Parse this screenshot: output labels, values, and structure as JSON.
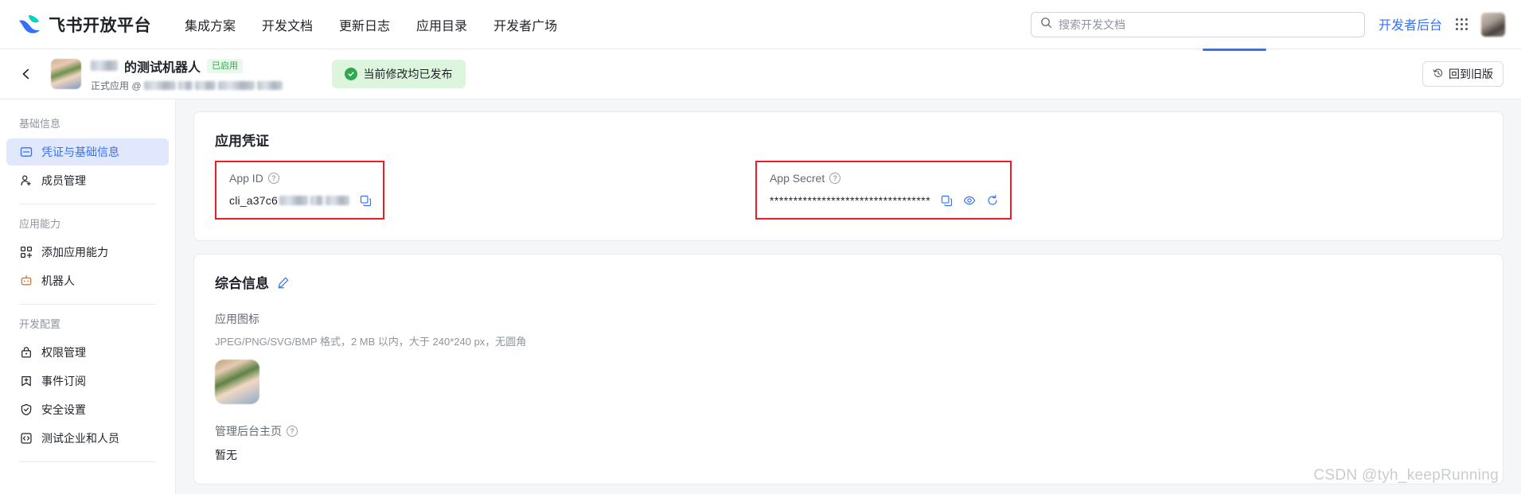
{
  "colors": {
    "accent_blue": "#3370ff",
    "success_green": "#2fa84f",
    "badge_green_bg": "#e8f8ea",
    "pill_green_bg": "#ddf5dd",
    "annotation_red": "#ee1c25",
    "sidebar_active_bg": "#e1e8fd",
    "page_bg": "#f5f6f7",
    "robot_orange": "#d97a24"
  },
  "header": {
    "brand": "飞书开放平台",
    "brand_logo_icon": "feishu-logo-icon",
    "nav": [
      {
        "label": "集成方案"
      },
      {
        "label": "开发文档"
      },
      {
        "label": "更新日志"
      },
      {
        "label": "应用目录"
      },
      {
        "label": "开发者广场"
      }
    ],
    "search": {
      "placeholder": "搜索开发文档",
      "value": "",
      "icon": "search-icon"
    },
    "dev_console_label": "开发者后台",
    "grid_icon": "app-grid-icon",
    "avatar_icon": "user-avatar"
  },
  "subheader": {
    "back_icon": "chevron-left-icon",
    "app_avatar_icon": "app-avatar-image",
    "app_name_masked_prefix": "",
    "app_name": "的测试机器人",
    "status_badge": "已启用",
    "app_type_line": "正式应用 @",
    "publish_status": "当前修改均已发布",
    "publish_icon": "check-circle-icon",
    "old_version_button": "回到旧版",
    "old_version_icon": "history-clock-icon"
  },
  "sidebar": {
    "groups": [
      {
        "title": "基础信息",
        "items": [
          {
            "label": "凭证与基础信息",
            "icon": "credentials-icon",
            "active": true
          },
          {
            "label": "成员管理",
            "icon": "member-add-icon",
            "active": false
          }
        ]
      },
      {
        "title": "应用能力",
        "items": [
          {
            "label": "添加应用能力",
            "icon": "add-capability-icon",
            "active": false
          },
          {
            "label": "机器人",
            "icon": "robot-icon",
            "active": false
          }
        ]
      },
      {
        "title": "开发配置",
        "items": [
          {
            "label": "权限管理",
            "icon": "lock-icon",
            "active": false
          },
          {
            "label": "事件订阅",
            "icon": "bookmark-plus-icon",
            "active": false
          },
          {
            "label": "安全设置",
            "icon": "shield-check-icon",
            "active": false
          },
          {
            "label": "测试企业和人员",
            "icon": "code-brackets-icon",
            "active": false
          }
        ]
      }
    ]
  },
  "credentials_card": {
    "title": "应用凭证",
    "app_id": {
      "label": "App ID",
      "help_icon": "question-mark-icon",
      "value": "cli_a37c6",
      "value_masked": true,
      "copy_icon": "copy-icon"
    },
    "app_secret": {
      "label": "App Secret",
      "help_icon": "question-mark-icon",
      "value": "**********************************",
      "copy_icon": "copy-icon",
      "reveal_icon": "eye-icon",
      "refresh_icon": "refresh-icon"
    }
  },
  "info_card": {
    "title": "综合信息",
    "edit_icon": "pencil-edit-icon",
    "app_icon_label": "应用图标",
    "app_icon_hint": "JPEG/PNG/SVG/BMP 格式，2 MB 以内，大于 240*240 px，无圆角",
    "app_icon_image": "app-icon-preview",
    "admin_home_label": "管理后台主页",
    "admin_home_help_icon": "question-mark-icon",
    "admin_home_value": "暂无"
  },
  "watermark": "CSDN @tyh_keepRunning"
}
